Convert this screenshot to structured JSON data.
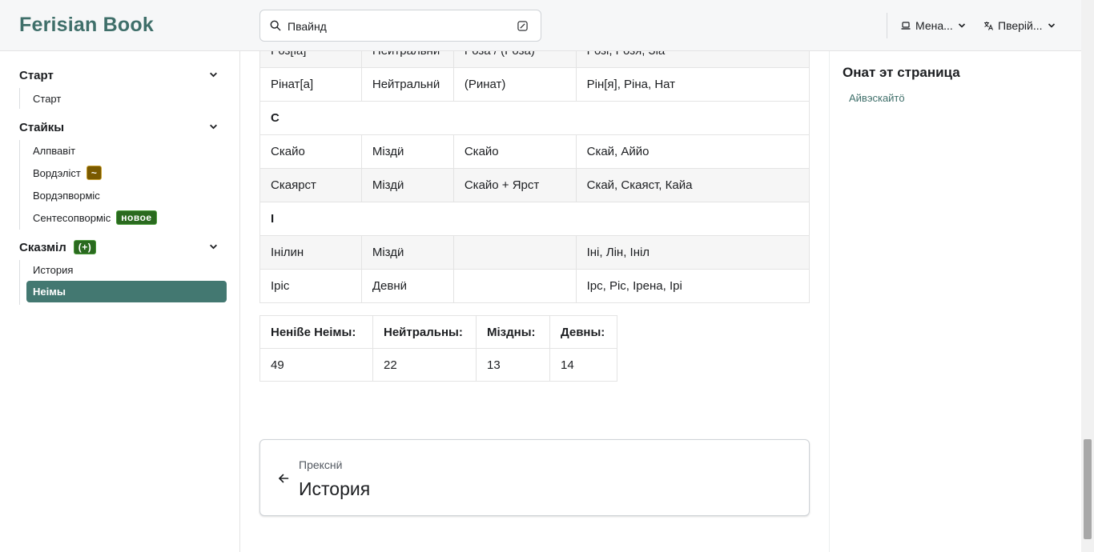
{
  "header": {
    "brand": "Ferisian Book",
    "search_placeholder": "Пвайнд",
    "menu_label": "Мена...",
    "lang_label": "Пверій..."
  },
  "sidebar": {
    "categories": [
      {
        "label": "Старт",
        "items": [
          {
            "label": "Старт"
          }
        ]
      },
      {
        "label": "Стайкы",
        "items": [
          {
            "label": "Алпвавіт"
          },
          {
            "label": "Вордэліст",
            "badge": "~"
          },
          {
            "label": "Вордэпворміс"
          },
          {
            "label": "Сентесопворміс",
            "badge": "новое"
          }
        ]
      },
      {
        "label": "Сказміл",
        "badge": "(+)",
        "items": [
          {
            "label": "История"
          },
          {
            "label": "Неімы",
            "active": true
          }
        ]
      }
    ]
  },
  "names_table": {
    "rows": [
      {
        "type": "row",
        "cells": [
          "Роз[іа]",
          "Нейтральнӥ",
          "Роза / (Роза)",
          "Розі, Розя, Зіа"
        ]
      },
      {
        "type": "row",
        "cells": [
          "Рінат[а]",
          "Нейтральнӥ",
          "(Ринат)",
          "Рін[я], Ріна, Нат"
        ]
      },
      {
        "type": "letter",
        "cells": [
          "С"
        ]
      },
      {
        "type": "row",
        "cells": [
          "Скайо",
          "Міздӥ",
          "Скайо",
          "Скай, Аййо"
        ]
      },
      {
        "type": "row",
        "cells": [
          "Скаярст",
          "Міздӥ",
          "Скайо + Ярст",
          "Скай, Скаяст, Кайа"
        ]
      },
      {
        "type": "letter",
        "cells": [
          "І"
        ]
      },
      {
        "type": "row",
        "cells": [
          "Інілин",
          "Міздӥ",
          "",
          "Іні, Лін, Ініл"
        ]
      },
      {
        "type": "row",
        "cells": [
          "Іріс",
          "Девнӥ",
          "",
          "Ірс, Ріс, Ірена, Ірі"
        ]
      }
    ]
  },
  "summary_table": {
    "headers": [
      "Неніße Неімы:",
      "Нейтральны:",
      "Міздны:",
      "Девны:"
    ],
    "values": [
      "49",
      "22",
      "13",
      "14"
    ]
  },
  "pager": {
    "sub": "Прекснӥ",
    "title": "История"
  },
  "toc": {
    "title": "Онат эт страница",
    "links": [
      "Айвэскайтӧ"
    ]
  }
}
